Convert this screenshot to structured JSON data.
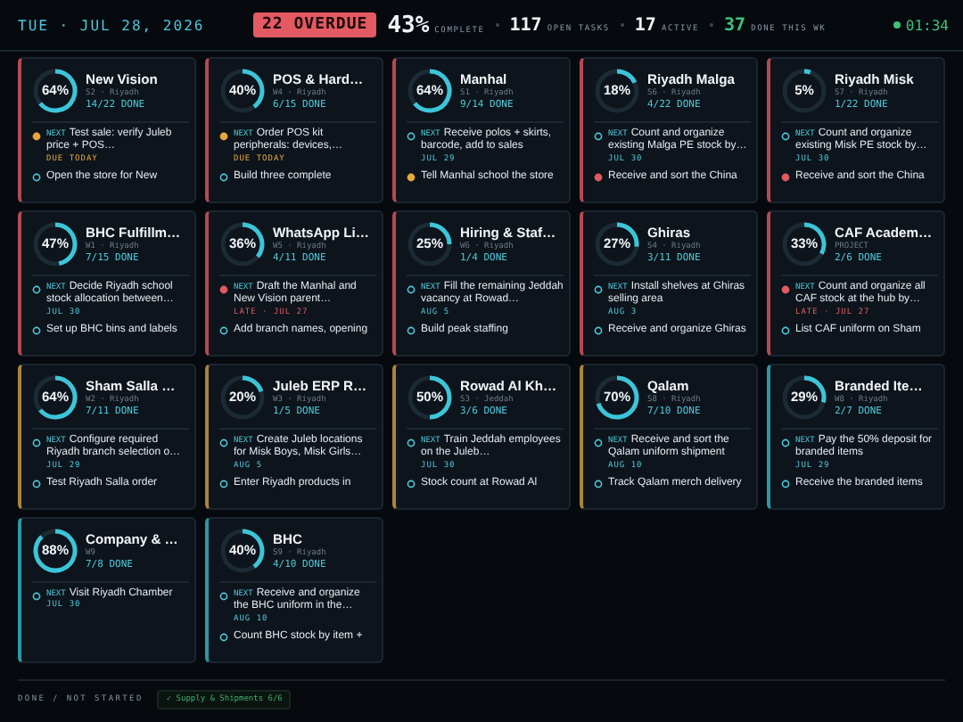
{
  "header": {
    "date": "TUE · JUL 28, 2026",
    "overdue": "22 OVERDUE",
    "stats": [
      {
        "value": "43%",
        "label": "COMPLETE",
        "kind": "big"
      },
      {
        "value": "117",
        "label": "OPEN TASKS",
        "kind": "plain"
      },
      {
        "value": "17",
        "label": "ACTIVE",
        "kind": "plain"
      },
      {
        "value": "37",
        "label": "DONE THIS WK",
        "kind": "good"
      }
    ],
    "clock": "01:34"
  },
  "cards": [
    {
      "title": "New Vision",
      "meta": "S2 · Riyadh",
      "done": "14/22 DONE",
      "percent": "64%",
      "color": "#b34a52",
      "next": {
        "label": "NEXT",
        "text": "Test sale: verify Juleb price + POS…",
        "due": "DUE TODAY",
        "kind": "today"
      },
      "then": {
        "text": "Open the store for New",
        "kind": "open"
      }
    },
    {
      "title": "POS & Hard…",
      "meta": "W4 · Riyadh",
      "done": "6/15 DONE",
      "percent": "40%",
      "color": "#b34a52",
      "next": {
        "label": "NEXT",
        "text": "Order POS kit peripherals: devices,…",
        "due": "DUE TODAY",
        "kind": "today"
      },
      "then": {
        "text": "Build three complete",
        "kind": "open"
      }
    },
    {
      "title": "Manhal",
      "meta": "S1 · Riyadh",
      "done": "9/14 DONE",
      "percent": "64%",
      "color": "#b34a52",
      "next": {
        "label": "NEXT",
        "text": "Receive polos + skirts, barcode, add to sales",
        "due": "JUL 29",
        "kind": "open"
      },
      "then": {
        "text": "Tell Manhal school the store",
        "kind": "today"
      }
    },
    {
      "title": "Riyadh Malga",
      "meta": "S6 · Riyadh",
      "done": "4/22 DONE",
      "percent": "18%",
      "color": "#b34a52",
      "next": {
        "label": "NEXT",
        "text": "Count and organize existing Malga PE stock by…",
        "due": "JUL 30",
        "kind": "open"
      },
      "then": {
        "text": "Receive and sort the China",
        "kind": "late"
      }
    },
    {
      "title": "Riyadh Misk",
      "meta": "S7 · Riyadh",
      "done": "1/22 DONE",
      "percent": "5%",
      "color": "#b34a52",
      "next": {
        "label": "NEXT",
        "text": "Count and organize existing Misk PE stock by…",
        "due": "JUL 30",
        "kind": "open"
      },
      "then": {
        "text": "Receive and sort the China",
        "kind": "late"
      }
    },
    {
      "title": "BHC Fulfillm…",
      "meta": "W1 · Riyadh",
      "done": "7/15 DONE",
      "percent": "47%",
      "color": "#b34a52",
      "next": {
        "label": "NEXT",
        "text": "Decide Riyadh school stock allocation between…",
        "due": "JUL 30",
        "kind": "open"
      },
      "then": {
        "text": "Set up BHC bins and labels",
        "kind": "open"
      }
    },
    {
      "title": "WhatsApp Li…",
      "meta": "W5 · Riyadh",
      "done": "4/11 DONE",
      "percent": "36%",
      "color": "#b34a52",
      "next": {
        "label": "NEXT",
        "text": "Draft the Manhal and New Vision parent…",
        "due": "LATE · JUL 27",
        "kind": "late"
      },
      "then": {
        "text": "Add branch names, opening",
        "kind": "open"
      }
    },
    {
      "title": "Hiring & Staf…",
      "meta": "W6 · Riyadh",
      "done": "1/4 DONE",
      "percent": "25%",
      "color": "#b34a52",
      "next": {
        "label": "NEXT",
        "text": "Fill the remaining Jeddah vacancy at Rowad…",
        "due": "AUG 5",
        "kind": "open"
      },
      "then": {
        "text": "Build peak staffing",
        "kind": "open"
      }
    },
    {
      "title": "Ghiras",
      "meta": "S4 · Riyadh",
      "done": "3/11 DONE",
      "percent": "27%",
      "color": "#b34a52",
      "next": {
        "label": "NEXT",
        "text": "Install shelves at Ghiras selling area",
        "due": "AUG 3",
        "kind": "open"
      },
      "then": {
        "text": "Receive and organize Ghiras",
        "kind": "open"
      }
    },
    {
      "title": "CAF Academ…",
      "meta": "PROJECT",
      "done": "2/6 DONE",
      "percent": "33%",
      "color": "#b34a52",
      "next": {
        "label": "NEXT",
        "text": "Count and organize all CAF stock at the hub by…",
        "due": "LATE · JUL 27",
        "kind": "late"
      },
      "then": {
        "text": "List CAF uniform on Sham",
        "kind": "open"
      }
    },
    {
      "title": "Sham Salla …",
      "meta": "W2 · Riyadh",
      "done": "7/11 DONE",
      "percent": "64%",
      "color": "#a8843a",
      "next": {
        "label": "NEXT",
        "text": "Configure required Riyadh branch selection o…",
        "due": "JUL 29",
        "kind": "open"
      },
      "then": {
        "text": "Test Riyadh Salla order",
        "kind": "open"
      }
    },
    {
      "title": "Juleb ERP R…",
      "meta": "W3 · Riyadh",
      "done": "1/5 DONE",
      "percent": "20%",
      "color": "#a8843a",
      "next": {
        "label": "NEXT",
        "text": "Create Juleb locations for Misk Boys, Misk Girls…",
        "due": "AUG 5",
        "kind": "open"
      },
      "then": {
        "text": "Enter Riyadh products in",
        "kind": "open"
      }
    },
    {
      "title": "Rowad Al Kh…",
      "meta": "S3 · Jeddah",
      "done": "3/6 DONE",
      "percent": "50%",
      "color": "#a8843a",
      "next": {
        "label": "NEXT",
        "text": "Train Jeddah employees on the Juleb…",
        "due": "JUL 30",
        "kind": "open"
      },
      "then": {
        "text": "Stock count at Rowad Al",
        "kind": "open"
      }
    },
    {
      "title": "Qalam",
      "meta": "S8 · Riyadh",
      "done": "7/10 DONE",
      "percent": "70%",
      "color": "#a8843a",
      "next": {
        "label": "NEXT",
        "text": "Receive and sort the Qalam uniform shipment",
        "due": "AUG 10",
        "kind": "open"
      },
      "then": {
        "text": "Track Qalam merch delivery",
        "kind": "open"
      }
    },
    {
      "title": "Branded Ite…",
      "meta": "W8 · Riyadh",
      "done": "2/7 DONE",
      "percent": "29%",
      "color": "#2a98a6",
      "next": {
        "label": "NEXT",
        "text": "Pay the 50% deposit for branded items",
        "due": "JUL 29",
        "kind": "open"
      },
      "then": {
        "text": "Receive the branded items",
        "kind": "open"
      }
    },
    {
      "title": "Company & …",
      "meta": "W9",
      "done": "7/8 DONE",
      "percent": "88%",
      "color": "#2a98a6",
      "next": {
        "label": "NEXT",
        "text": "Visit Riyadh Chamber",
        "due": "JUL 30",
        "kind": "open"
      }
    },
    {
      "title": "BHC",
      "meta": "S9 · Riyadh",
      "done": "4/10 DONE",
      "percent": "40%",
      "color": "#2a98a6",
      "next": {
        "label": "NEXT",
        "text": "Receive and organize the BHC uniform in the…",
        "due": "AUG 10",
        "kind": "open"
      },
      "then": {
        "text": "Count BHC stock by item +",
        "kind": "open"
      }
    }
  ],
  "footer": {
    "legend": "DONE / NOT STARTED",
    "chip": "✓ Supply & Shipments 6/6"
  }
}
